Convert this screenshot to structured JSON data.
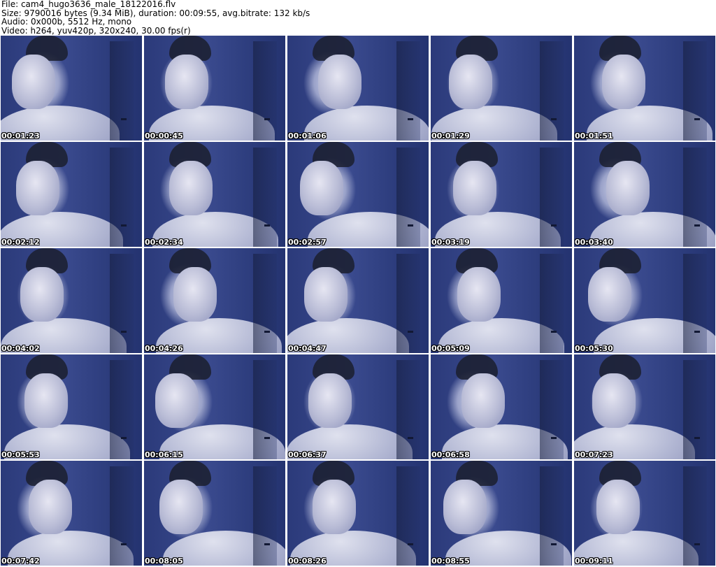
{
  "header": {
    "file_line": "File: cam4_hugo3636_male_18122016.flv",
    "size_line": "Size: 9790016 bytes (9.34 MiB), duration: 00:09:55, avg.bitrate: 132 kb/s",
    "audio_line": "Audio: 0x000b, 5512 Hz, mono",
    "video_line": "Video: h264, yuv420p, 320x240, 30.00 fps(r)"
  },
  "thumbnails": [
    {
      "timestamp": "00:01:23"
    },
    {
      "timestamp": "00:00:45"
    },
    {
      "timestamp": "00:01:06"
    },
    {
      "timestamp": "00:01:29"
    },
    {
      "timestamp": "00:01:51"
    },
    {
      "timestamp": "00:02:12"
    },
    {
      "timestamp": "00:02:34"
    },
    {
      "timestamp": "00:02:57"
    },
    {
      "timestamp": "00:03:19"
    },
    {
      "timestamp": "00:03:40"
    },
    {
      "timestamp": "00:04:02"
    },
    {
      "timestamp": "00:04:26"
    },
    {
      "timestamp": "00:04:47"
    },
    {
      "timestamp": "00:05:09"
    },
    {
      "timestamp": "00:05:30"
    },
    {
      "timestamp": "00:05:53"
    },
    {
      "timestamp": "00:06:15"
    },
    {
      "timestamp": "00:06:37"
    },
    {
      "timestamp": "00:06:58"
    },
    {
      "timestamp": "00:07:23"
    },
    {
      "timestamp": "00:07:42"
    },
    {
      "timestamp": "00:08:05"
    },
    {
      "timestamp": "00:08:26"
    },
    {
      "timestamp": "00:08:55"
    },
    {
      "timestamp": "00:09:11"
    }
  ]
}
